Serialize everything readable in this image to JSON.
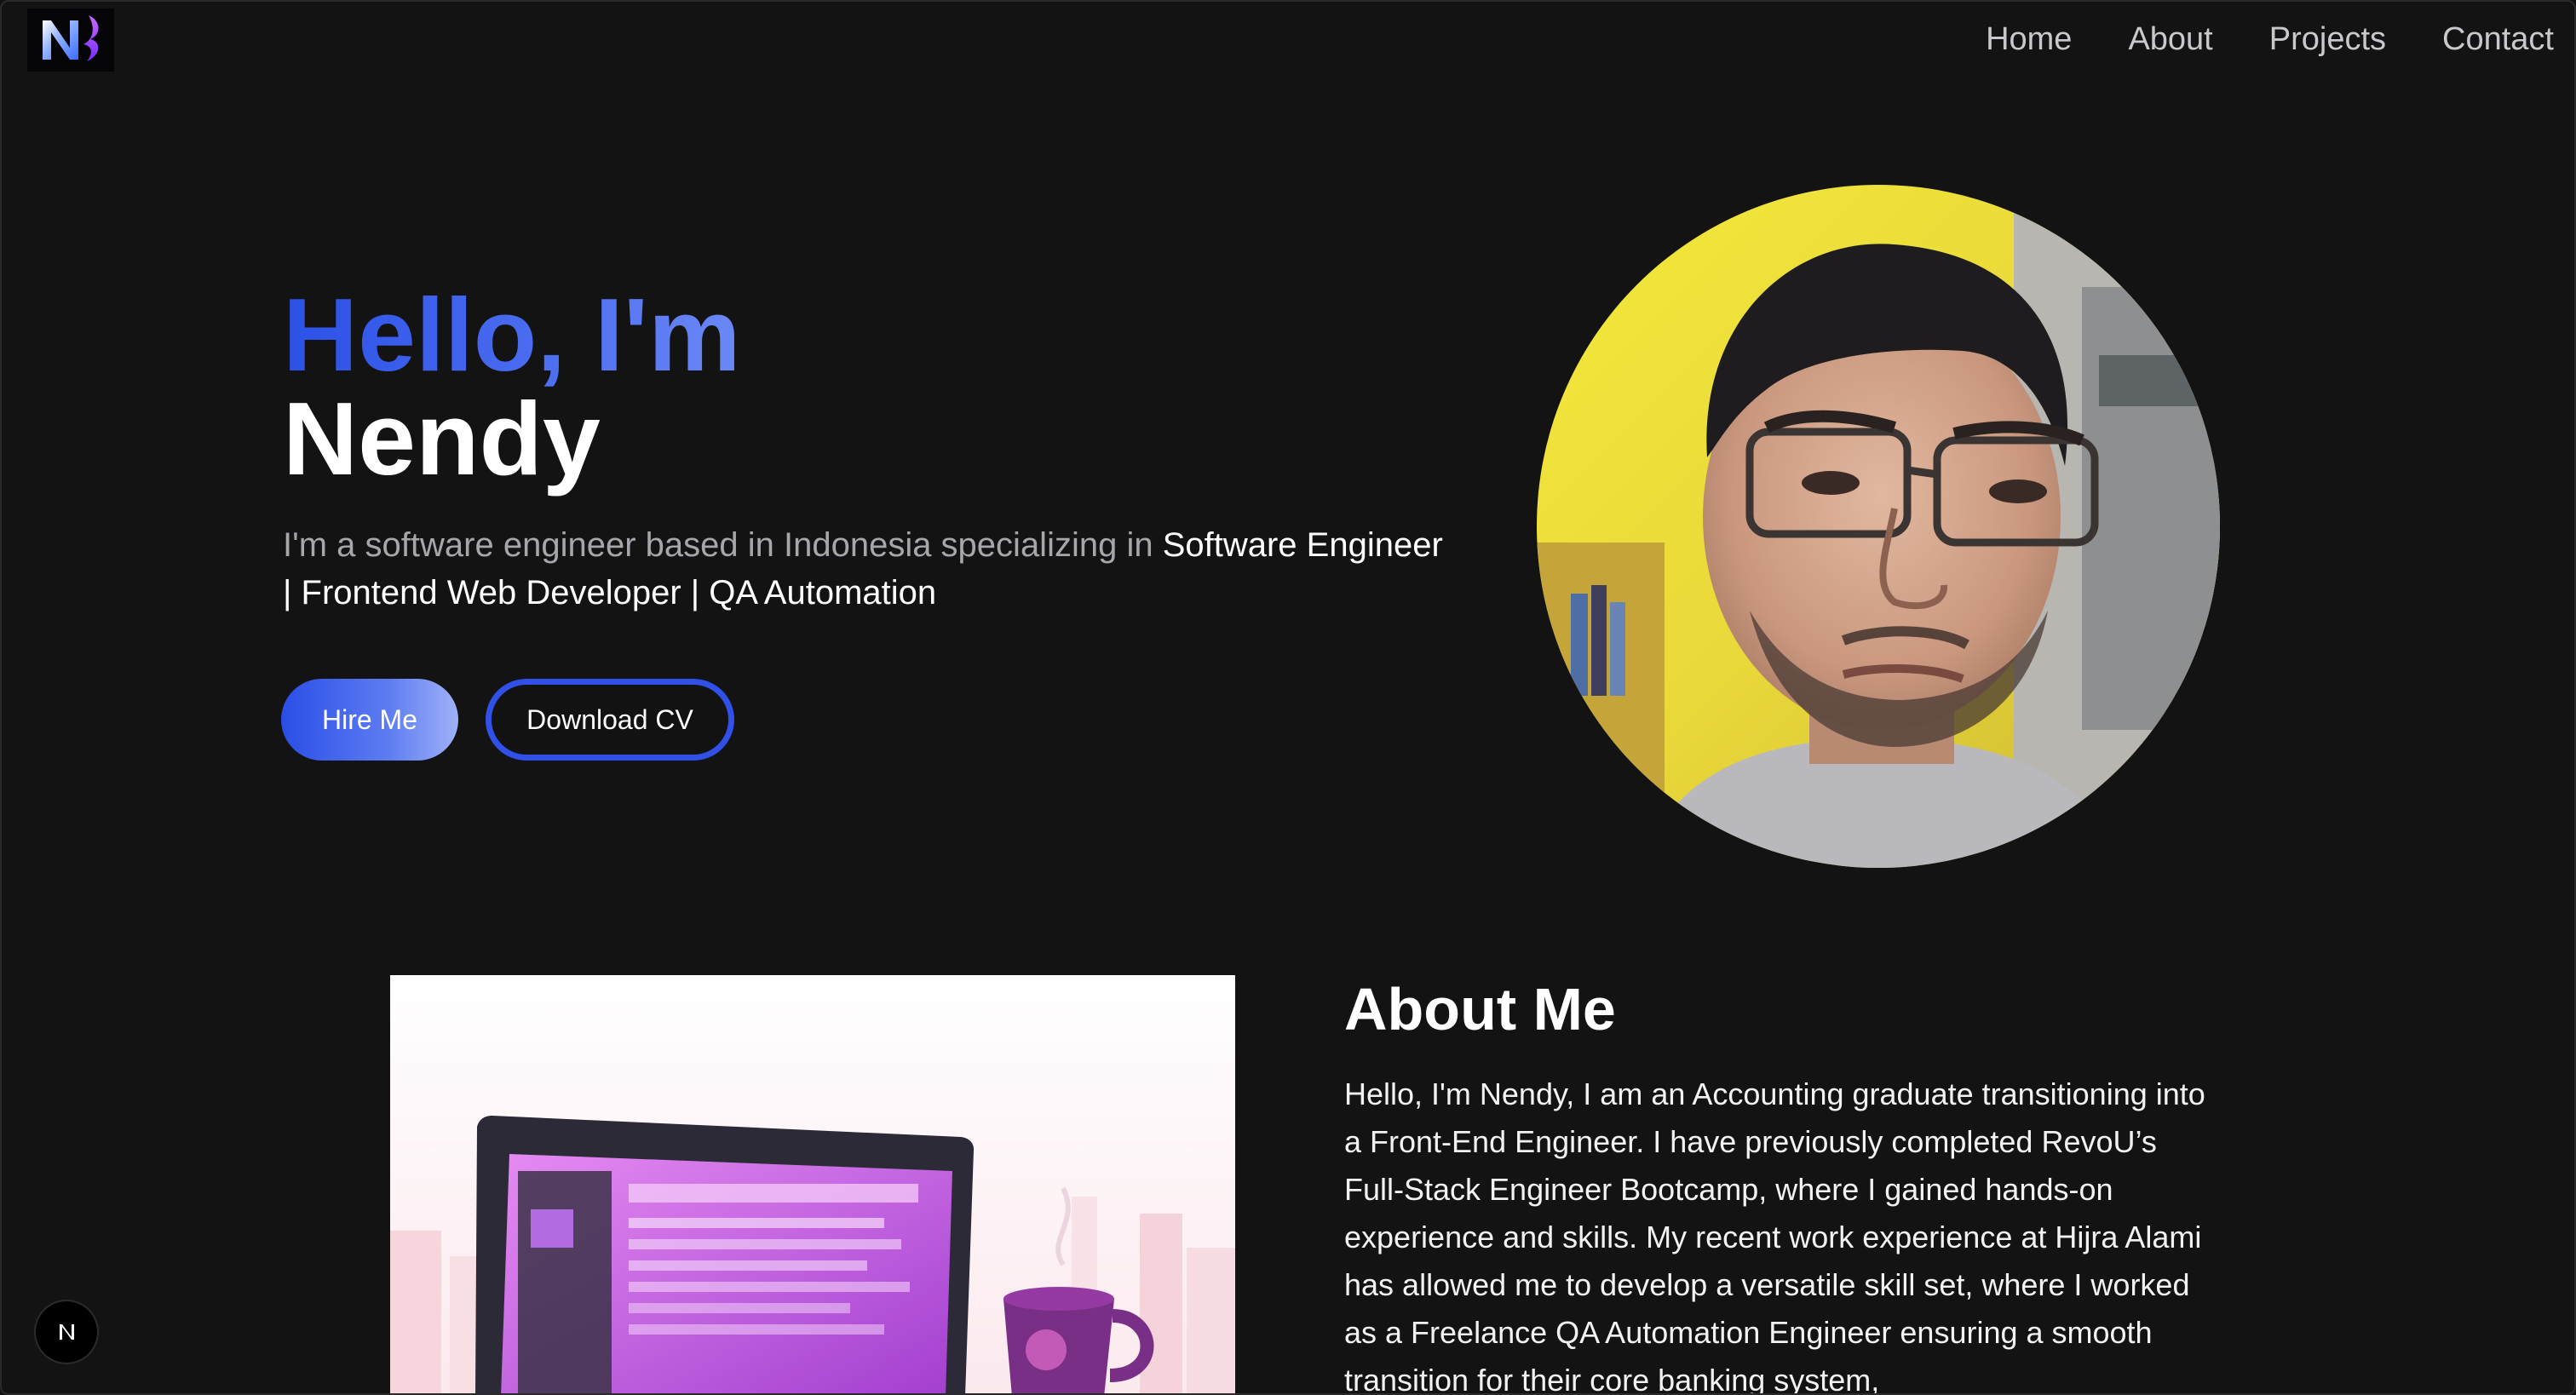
{
  "header": {
    "logo_text": "N",
    "nav": [
      {
        "label": "Home"
      },
      {
        "label": "About"
      },
      {
        "label": "Projects"
      },
      {
        "label": "Contact"
      }
    ]
  },
  "hero": {
    "greeting": "Hello, I'm",
    "name": "Nendy",
    "intro": "I'm a software engineer based in Indonesia specializing in ",
    "roles": "Software Engineer | Frontend Web Developer | QA Automation",
    "hire_button": "Hire Me",
    "cv_button": "Download CV"
  },
  "about": {
    "title": "About Me",
    "text": "Hello, I'm Nendy, I am an Accounting graduate transitioning into a Front-End Engineer. I have previously completed RevoU’s Full-Stack Engineer Bootcamp, where I gained hands-on experience and skills. My recent work experience at Hijra Alami has allowed me to develop a versatile skill set, where I worked as a Freelance QA Automation Engineer ensuring a smooth transition for their core banking system,"
  },
  "badge": {
    "icon": "nextjs-n-icon"
  },
  "colors": {
    "background": "#131314",
    "accent": "#2b51e6",
    "nav_text": "#c9c9cd",
    "muted_text": "#a6a6ab"
  }
}
